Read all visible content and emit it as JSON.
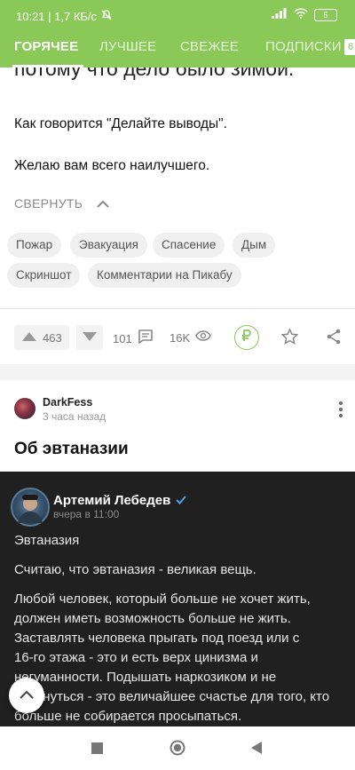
{
  "status_bar": {
    "time_speed": "10:21 | 1,7 КБ/с",
    "battery": "5"
  },
  "tabs": [
    {
      "label": "ГОРЯЧЕЕ"
    },
    {
      "label": "ЛУЧШЕЕ"
    },
    {
      "label": "СВЕЖЕЕ"
    },
    {
      "label": "ПОДПИСКИ"
    }
  ],
  "tabs_badge": "6",
  "post1": {
    "partial_line": "потому что дело было зимой.",
    "para1": "Как говорится \"Делайте выводы\".",
    "para2": "Желаю вам всего наилучшего.",
    "collapse_label": "СВЕРНУТЬ",
    "tags": [
      "Пожар",
      "Эвакуация",
      "Спасение",
      "Дым",
      "Скриншот",
      "Комментарии на Пикабу"
    ],
    "votes": "463",
    "comments": "101",
    "views": "16K"
  },
  "post2": {
    "author": "DarkFess",
    "time": "3 часа назад",
    "title": "Об эвтаназии",
    "embed": {
      "name": "Артемий Лебедев",
      "time": "вчера в 11:00",
      "line1": "Эвтаназия",
      "line2": "Считаю, что эвтаназия - великая вещь.",
      "para_lines": [
        "Любой человек, который больше не хочет жить,",
        "должен иметь возможность больше не жить.",
        "Заставлять человека прыгать под поезд или с",
        "16-го этажа - это и есть верх цинизма и",
        "негуманности. Подышать наркозиком и не",
        "проснуться - это величайшее счастье для того, кто",
        "больше не собирается просыпаться."
      ]
    }
  },
  "colors": {
    "brand_green": "#8ac858",
    "embed_bg": "#202020"
  }
}
